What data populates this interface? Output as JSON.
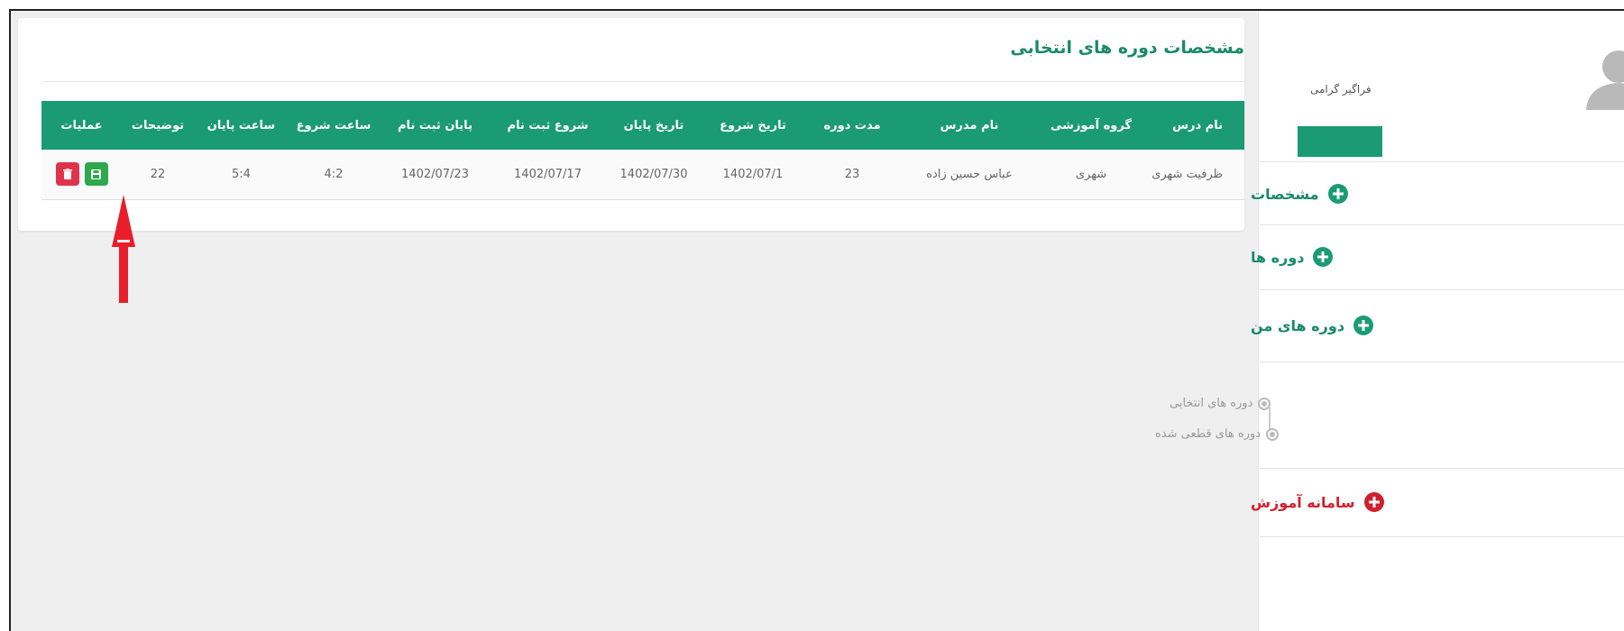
{
  "panel": {
    "title": "مشخصات دوره های انتخابی"
  },
  "table": {
    "headers": [
      "نام درس",
      "گروه آموزشی",
      "نام مدرس",
      "مدت دوره",
      "تاریخ شروع",
      "تاریخ پایان",
      "شروع ثبت نام",
      "پایان ثبت نام",
      "ساعت شروع",
      "ساعت پایان",
      "توضیحات",
      "عملیات"
    ],
    "rows": [
      {
        "course_name": "ظرفیت شهری",
        "group": "شهری",
        "teacher": "عباس حسین زاده",
        "duration": "23",
        "start_date": "1402/07/1",
        "end_date": "1402/07/30",
        "reg_start": "1402/07/17",
        "reg_end": "1402/07/23",
        "start_time": "4:2",
        "end_time": "5:4",
        "description": "22"
      }
    ]
  },
  "sidebar": {
    "greeting": "فراگیر گرامی",
    "menu": [
      {
        "label": "مشخصات"
      },
      {
        "label": "دوره ها"
      },
      {
        "label": "دوره های من"
      }
    ],
    "submenu": [
      {
        "label": "دوره های انتخابی"
      },
      {
        "label": "دوره های قطعی شده"
      }
    ],
    "system": {
      "label": "سامانه آموزش"
    }
  },
  "colors": {
    "accent": "#1b9b74",
    "title": "#1a8a69",
    "delete": "#e0334b",
    "save": "#2da84a",
    "annotation": "#e81e2a"
  },
  "icons": {
    "delete": "trash-icon",
    "save": "floppy-disk-icon",
    "menu": "plus-circle-icon",
    "avatar": "user-silhouette-icon",
    "annotation": "red-arrow-up-icon"
  }
}
